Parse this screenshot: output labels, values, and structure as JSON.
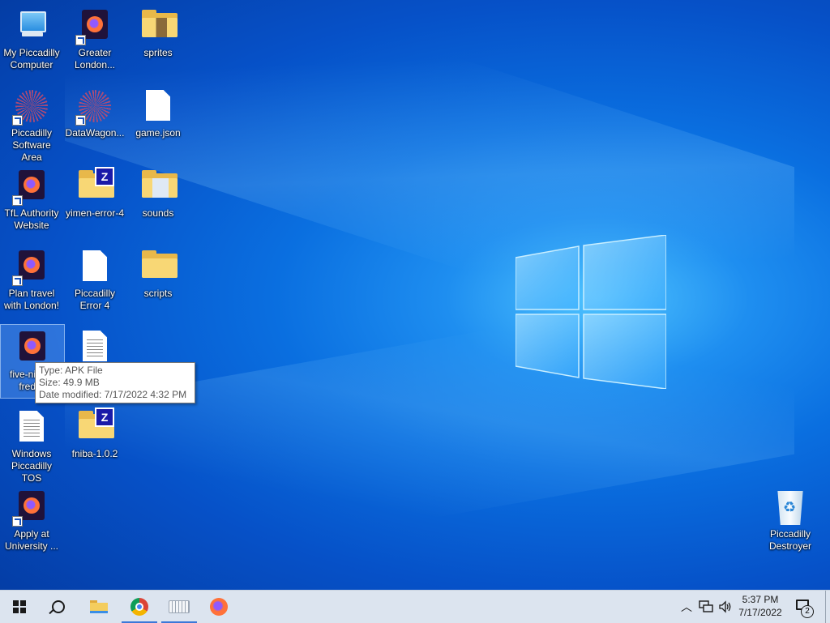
{
  "desktop": {
    "icons": [
      {
        "label": "My Piccadilly Computer",
        "icon": "computer-icon",
        "shortcut": false
      },
      {
        "label": "Greater London...",
        "icon": "firefox-icon",
        "shortcut": true
      },
      {
        "label": "sprites",
        "icon": "folder-icon",
        "shortcut": false
      },
      {
        "label": "Piccadilly Software Area",
        "icon": "gear-icon",
        "shortcut": true
      },
      {
        "label": "DataWagon...",
        "icon": "gear-icon",
        "shortcut": true
      },
      {
        "label": "game.json",
        "icon": "document-icon",
        "shortcut": false
      },
      {
        "label": "TfL Authority Website",
        "icon": "firefox-icon",
        "shortcut": true
      },
      {
        "label": "yimen-error-4",
        "icon": "zip-folder-icon",
        "shortcut": false
      },
      {
        "label": "sounds",
        "icon": "folder-icon",
        "shortcut": false
      },
      {
        "label": "Plan travel with London!",
        "icon": "firefox-icon",
        "shortcut": true
      },
      {
        "label": "Piccadilly Error 4",
        "icon": "document-icon",
        "shortcut": false
      },
      {
        "label": "scripts",
        "icon": "folder-icon",
        "shortcut": false
      },
      {
        "label": "five-nig... -freddy",
        "icon": "firefox-icon",
        "shortcut": false,
        "selected": true
      },
      {
        "label": "",
        "icon": "text-document-icon",
        "shortcut": false
      },
      {
        "label": "Windows Piccadilly TOS",
        "icon": "text-document-icon",
        "shortcut": false
      },
      {
        "label": "fniba-1.0.2",
        "icon": "zip-folder-icon",
        "shortcut": false
      },
      {
        "label": "Apply at University ...",
        "icon": "firefox-icon",
        "shortcut": true
      },
      {
        "label": "Piccadilly Destroyer",
        "icon": "recycle-bin-icon",
        "shortcut": false
      }
    ],
    "tooltip": {
      "type": "Type: APK File",
      "size": "Size: 49.9 MB",
      "modified": "Date modified: 7/17/2022 4:32 PM"
    }
  },
  "taskbar": {
    "buttons": [
      "windows-start-icon",
      "search-icon",
      "file-explorer-icon",
      "chrome-icon",
      "keyboard-icon",
      "firefox-icon"
    ],
    "tray_icons": [
      "chevron-up-icon",
      "network-icon",
      "volume-icon"
    ],
    "time": "5:37 PM",
    "date": "7/17/2022",
    "notification_count": "2"
  },
  "zip_glyph": "Z",
  "colors": {
    "desktop_blue": "#0a6fe0",
    "taskbar_bg": "#dce4ef",
    "accent": "#3b78d8"
  }
}
